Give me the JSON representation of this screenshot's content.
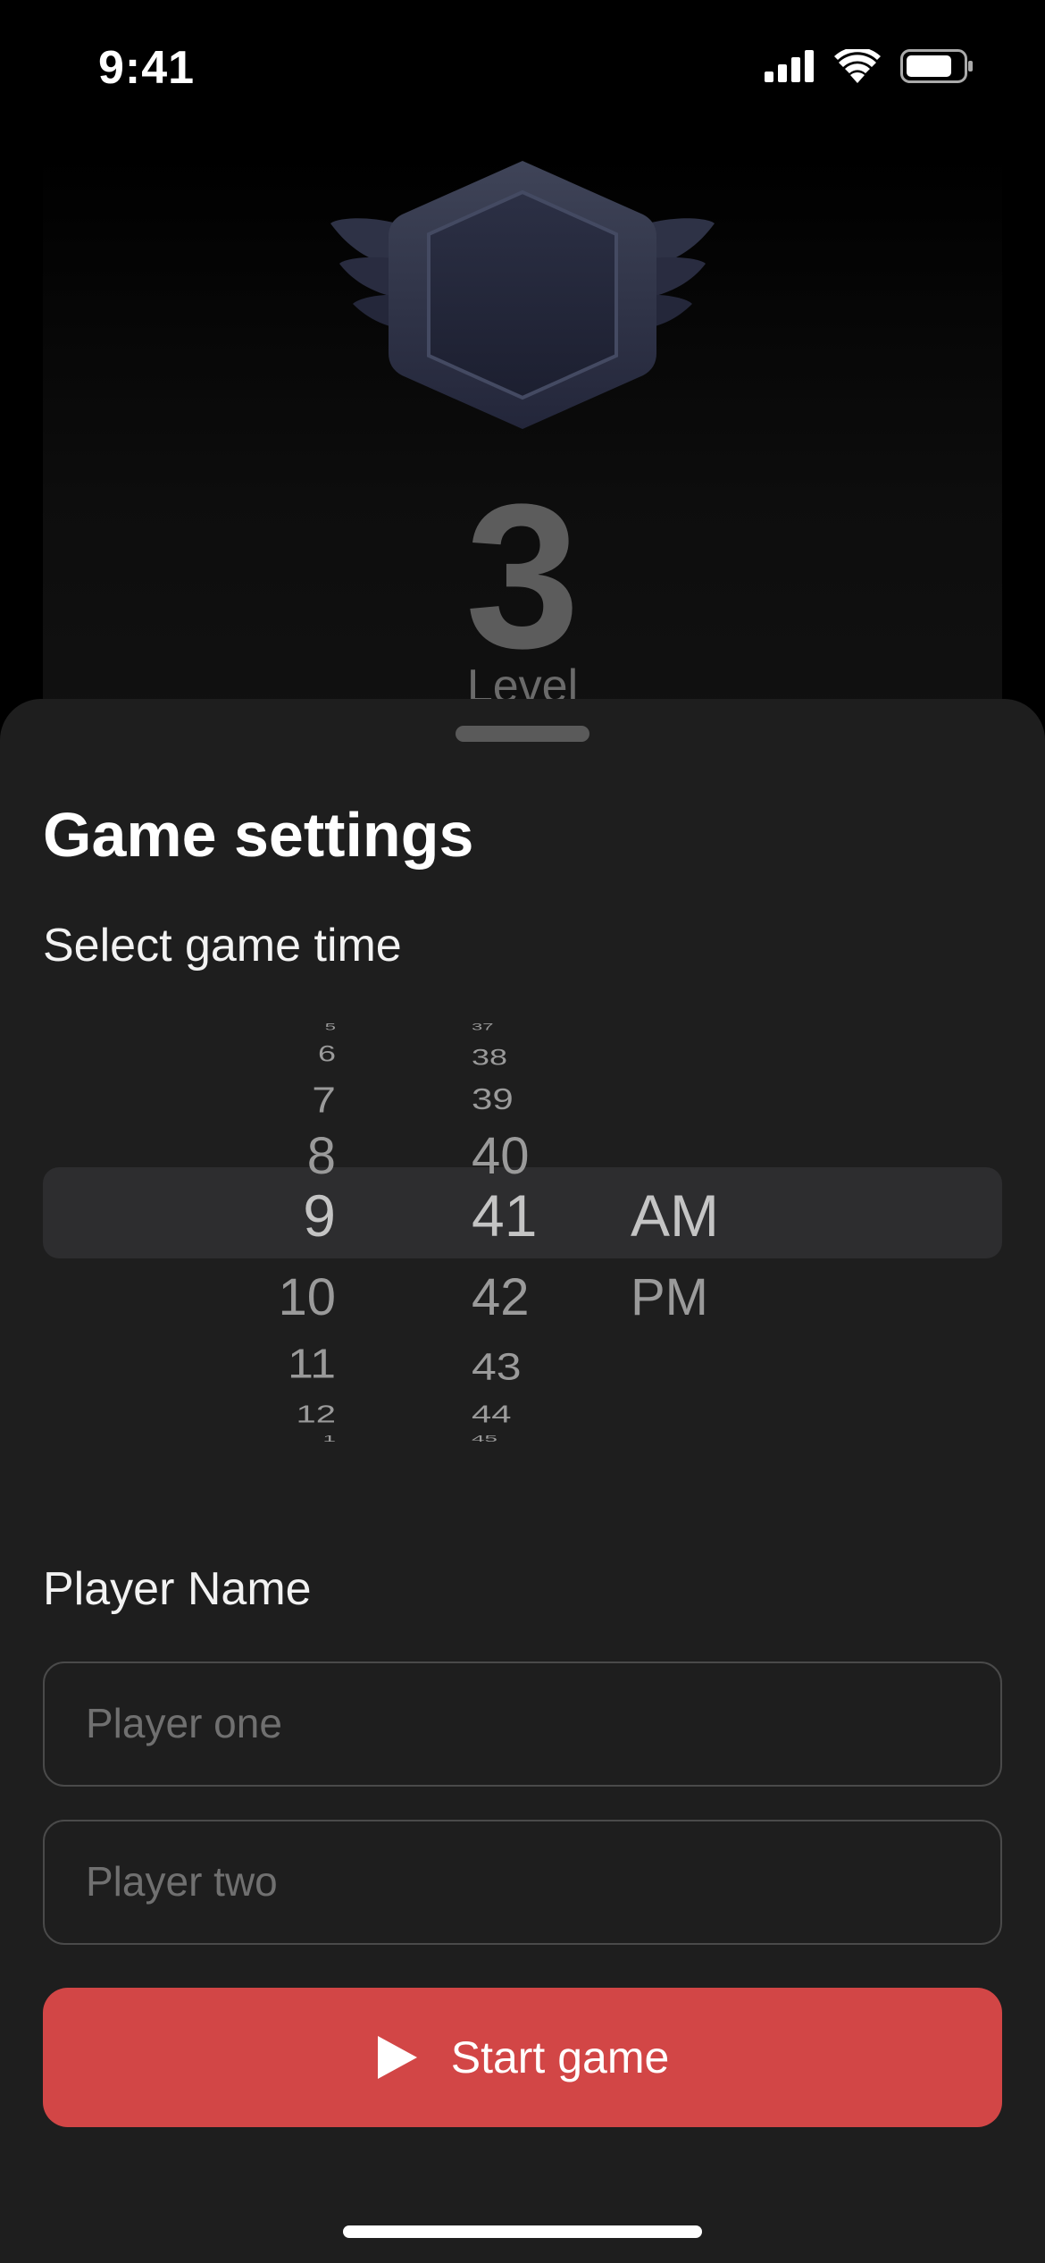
{
  "status_bar": {
    "time": "9:41"
  },
  "hero": {
    "level_number": "3",
    "level_label": "Level"
  },
  "sheet": {
    "title": "Game settings",
    "time_label": "Select game time",
    "picker": {
      "hours": [
        "5",
        "6",
        "7",
        "8",
        "9",
        "10",
        "11",
        "12",
        "1"
      ],
      "minutes": [
        "37",
        "38",
        "39",
        "40",
        "41",
        "42",
        "43",
        "44",
        "45"
      ],
      "periods": [
        "AM",
        "PM"
      ],
      "selected": {
        "hour": "9",
        "minute": "41",
        "period": "AM"
      }
    },
    "player_label": "Player Name",
    "player_one_placeholder": "Player one",
    "player_two_placeholder": "Player two",
    "start_button_label": "Start game"
  },
  "colors": {
    "accent": "#d24646",
    "sheet_background": "#1e1e1e",
    "picker_highlight": "#2d2d2f"
  },
  "icons": [
    "cellular-signal-icon",
    "wifi-icon",
    "battery-icon",
    "level-badge-icon",
    "play-icon"
  ]
}
